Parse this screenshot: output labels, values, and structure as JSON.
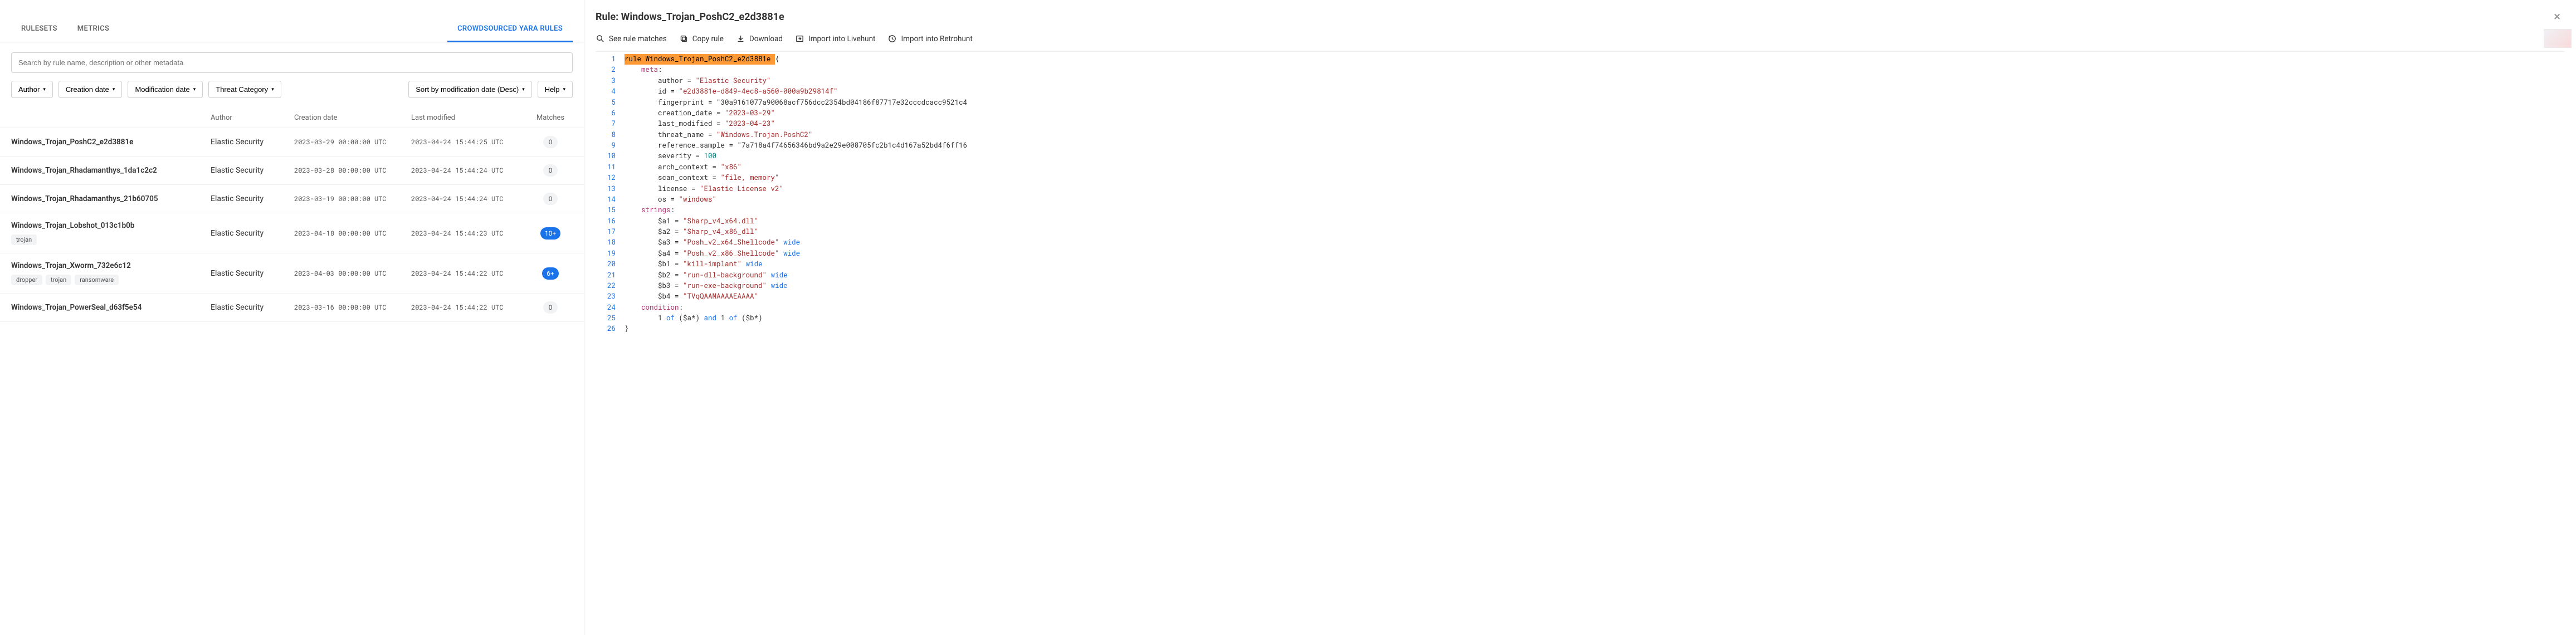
{
  "tabs": {
    "rulesets": "RULESETS",
    "metrics": "METRICS",
    "crowdsourced": "CROWDSOURCED YARA RULES"
  },
  "search": {
    "placeholder": "Search by rule name, description or other metadata"
  },
  "filters": {
    "author": "Author",
    "creation": "Creation date",
    "modification": "Modification date",
    "threat": "Threat Category",
    "sort": "Sort by modification date (Desc)",
    "help": "Help"
  },
  "columns": {
    "author": "Author",
    "created": "Creation date",
    "modified": "Last modified",
    "matches": "Matches"
  },
  "rows": [
    {
      "name": "Windows_Trojan_PoshC2_e2d3881e",
      "author": "Elastic Security",
      "created": "2023-03-29 00:00:00 UTC",
      "modified": "2023-04-24 15:44:25 UTC",
      "matches": "0",
      "blue": false,
      "tags": []
    },
    {
      "name": "Windows_Trojan_Rhadamanthys_1da1c2c2",
      "author": "Elastic Security",
      "created": "2023-03-28 00:00:00 UTC",
      "modified": "2023-04-24 15:44:24 UTC",
      "matches": "0",
      "blue": false,
      "tags": []
    },
    {
      "name": "Windows_Trojan_Rhadamanthys_21b60705",
      "author": "Elastic Security",
      "created": "2023-03-19 00:00:00 UTC",
      "modified": "2023-04-24 15:44:24 UTC",
      "matches": "0",
      "blue": false,
      "tags": []
    },
    {
      "name": "Windows_Trojan_Lobshot_013c1b0b",
      "author": "Elastic Security",
      "created": "2023-04-18 00:00:00 UTC",
      "modified": "2023-04-24 15:44:23 UTC",
      "matches": "10+",
      "blue": true,
      "tags": [
        "trojan"
      ]
    },
    {
      "name": "Windows_Trojan_Xworm_732e6c12",
      "author": "Elastic Security",
      "created": "2023-04-03 00:00:00 UTC",
      "modified": "2023-04-24 15:44:22 UTC",
      "matches": "6+",
      "blue": true,
      "tags": [
        "dropper",
        "trojan",
        "ransomware"
      ]
    },
    {
      "name": "Windows_Trojan_PowerSeal_d63f5e54",
      "author": "Elastic Security",
      "created": "2023-03-16 00:00:00 UTC",
      "modified": "2023-04-24 15:44:22 UTC",
      "matches": "0",
      "blue": false,
      "tags": []
    }
  ],
  "detail": {
    "title_prefix": "Rule: ",
    "title_name": "Windows_Trojan_PoshC2_e2d3881e",
    "actions": {
      "see": "See rule matches",
      "copy": "Copy rule",
      "download": "Download",
      "livehunt": "Import into Livehunt",
      "retrohunt": "Import into Retrohunt"
    },
    "code_lines": [
      {
        "n": 1,
        "raw": "rule Windows_Trojan_PoshC2_e2d3881e {",
        "hl": true
      },
      {
        "n": 2,
        "raw": "    meta:"
      },
      {
        "n": 3,
        "raw": "        author = \"Elastic Security\""
      },
      {
        "n": 4,
        "raw": "        id = \"e2d3881e-d849-4ec8-a560-000a9b29814f\""
      },
      {
        "n": 5,
        "raw": "        fingerprint = \"30a9161077a90068acf756dcc2354bd04186f87717e32cccdcacc9521c4"
      },
      {
        "n": 6,
        "raw": "        creation_date = \"2023-03-29\""
      },
      {
        "n": 7,
        "raw": "        last_modified = \"2023-04-23\""
      },
      {
        "n": 8,
        "raw": "        threat_name = \"Windows.Trojan.PoshC2\""
      },
      {
        "n": 9,
        "raw": "        reference_sample = \"7a718a4f74656346bd9a2e29e008705fc2b1c4d167a52bd4f6ff16"
      },
      {
        "n": 10,
        "raw": "        severity = 100"
      },
      {
        "n": 11,
        "raw": "        arch_context = \"x86\""
      },
      {
        "n": 12,
        "raw": "        scan_context = \"file, memory\""
      },
      {
        "n": 13,
        "raw": "        license = \"Elastic License v2\""
      },
      {
        "n": 14,
        "raw": "        os = \"windows\""
      },
      {
        "n": 15,
        "raw": "    strings:"
      },
      {
        "n": 16,
        "raw": "        $a1 = \"Sharp_v4_x64.dll\""
      },
      {
        "n": 17,
        "raw": "        $a2 = \"Sharp_v4_x86_dll\""
      },
      {
        "n": 18,
        "raw": "        $a3 = \"Posh_v2_x64_Shellcode\" wide"
      },
      {
        "n": 19,
        "raw": "        $a4 = \"Posh_v2_x86_Shellcode\" wide"
      },
      {
        "n": 20,
        "raw": "        $b1 = \"kill-implant\" wide"
      },
      {
        "n": 21,
        "raw": "        $b2 = \"run-dll-background\" wide"
      },
      {
        "n": 22,
        "raw": "        $b3 = \"run-exe-background\" wide"
      },
      {
        "n": 23,
        "raw": "        $b4 = \"TVqQAAMAAAAEAAAA\""
      },
      {
        "n": 24,
        "raw": "    condition:"
      },
      {
        "n": 25,
        "raw": "        1 of ($a*) and 1 of ($b*)"
      },
      {
        "n": 26,
        "raw": "}"
      }
    ]
  }
}
